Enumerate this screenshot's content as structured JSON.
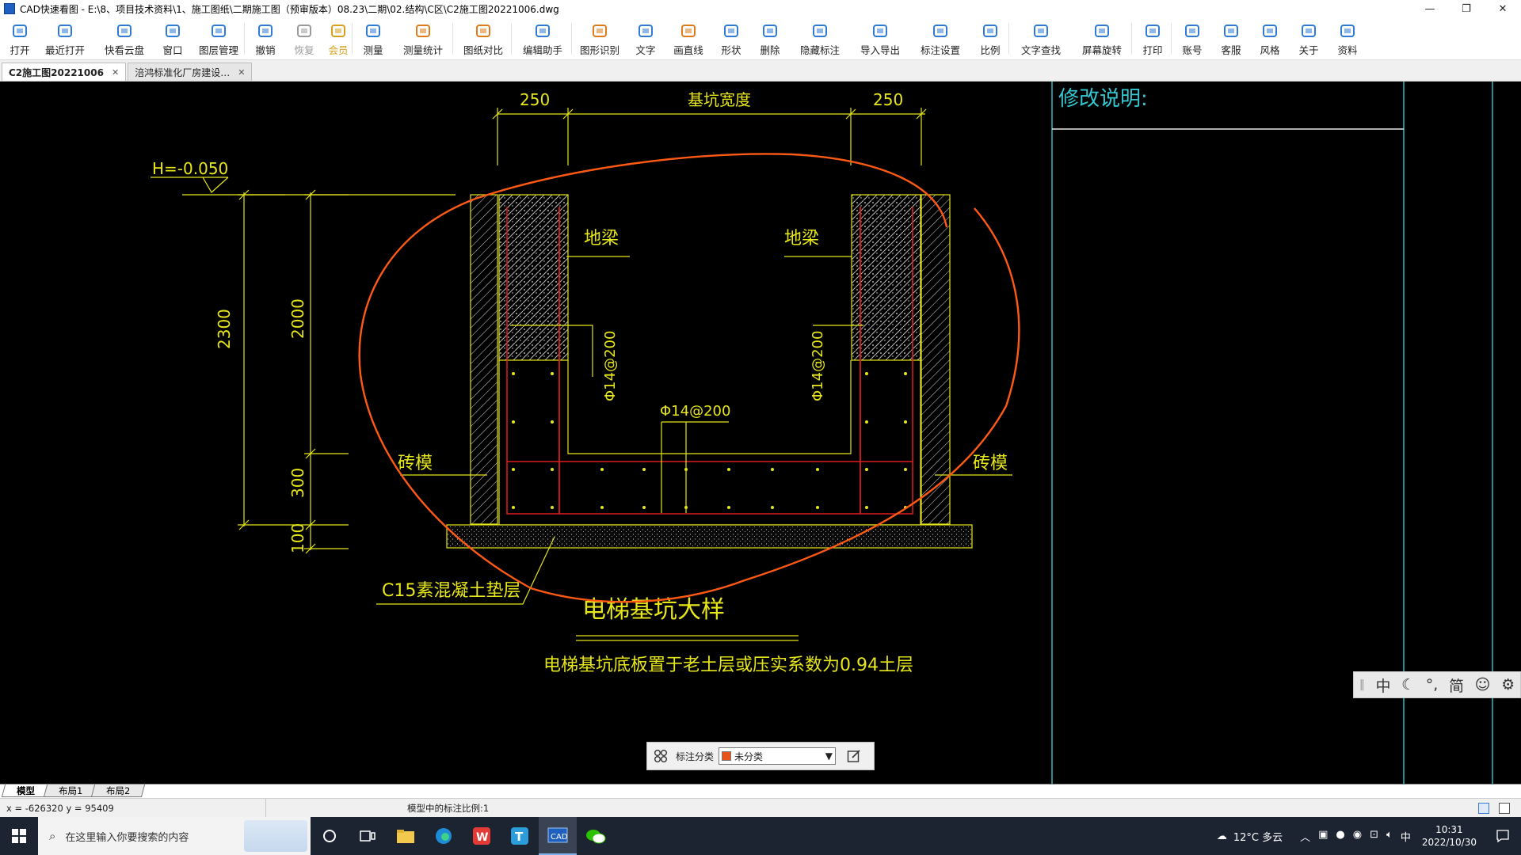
{
  "window": {
    "title": "CAD快速看图 - E:\\8、项目技术资料\\1、施工图纸\\二期施工图（预审版本）08.23\\二期\\02.结构\\C区\\C2施工图20221006.dwg",
    "minimize": "—",
    "maximize": "❐",
    "close": "✕"
  },
  "toolbar": {
    "items": [
      {
        "label": "打开",
        "icon": "folder-open-icon",
        "color": "#2e7bd6"
      },
      {
        "label": "最近打开",
        "icon": "history-icon",
        "color": "#2e7bd6"
      },
      {
        "label": "快看云盘",
        "icon": "cloud-icon",
        "color": "#2e7bd6"
      },
      {
        "label": "窗口",
        "icon": "window-icon",
        "color": "#2e7bd6"
      },
      {
        "label": "图层管理",
        "icon": "layers-icon",
        "color": "#2e7bd6"
      },
      {
        "label": "撤销",
        "icon": "undo-icon",
        "color": "#2e7bd6"
      },
      {
        "label": "恢复",
        "icon": "redo-icon",
        "color": "#9a9a9a"
      },
      {
        "label": "会员",
        "icon": "vip-icon",
        "color": "#d9a11b"
      },
      {
        "label": "测量",
        "icon": "measure-icon",
        "color": "#2e7bd6"
      },
      {
        "label": "测量统计",
        "icon": "measure-stats-icon",
        "color": "#e07b1a"
      },
      {
        "label": "图纸对比",
        "icon": "compare-icon",
        "color": "#e07b1a"
      },
      {
        "label": "编辑助手",
        "icon": "edit-assistant-icon",
        "color": "#2e7bd6"
      },
      {
        "label": "图形识别",
        "icon": "shape-recognition-icon",
        "color": "#e07b1a"
      },
      {
        "label": "文字",
        "icon": "text-icon",
        "color": "#2e7bd6"
      },
      {
        "label": "画直线",
        "icon": "line-icon",
        "color": "#e07b1a"
      },
      {
        "label": "形状",
        "icon": "shape-icon",
        "color": "#2e7bd6"
      },
      {
        "label": "删除",
        "icon": "eraser-icon",
        "color": "#2e7bd6"
      },
      {
        "label": "隐藏标注",
        "icon": "hide-annotation-icon",
        "color": "#2e7bd6"
      },
      {
        "label": "导入导出",
        "icon": "import-export-icon",
        "color": "#2e7bd6"
      },
      {
        "label": "标注设置",
        "icon": "annotation-settings-icon",
        "color": "#2e7bd6"
      },
      {
        "label": "比例",
        "icon": "scale-icon",
        "color": "#2e7bd6"
      },
      {
        "label": "文字查找",
        "icon": "text-search-icon",
        "color": "#2e7bd6"
      },
      {
        "label": "屏幕旋转",
        "icon": "rotate-screen-icon",
        "color": "#2e7bd6"
      },
      {
        "label": "打印",
        "icon": "print-icon",
        "color": "#2e7bd6"
      },
      {
        "label": "账号",
        "icon": "account-icon",
        "color": "#2e7bd6"
      },
      {
        "label": "客服",
        "icon": "headset-icon",
        "color": "#2e7bd6"
      },
      {
        "label": "风格",
        "icon": "style-icon",
        "color": "#2e7bd6"
      },
      {
        "label": "关于",
        "icon": "info-icon",
        "color": "#2e7bd6"
      },
      {
        "label": "资料",
        "icon": "documents-icon",
        "color": "#2e7bd6"
      }
    ]
  },
  "doc_tabs": [
    {
      "label": "C2施工图20221006",
      "active": true
    },
    {
      "label": "涪鸿标准化厂房建设…",
      "active": false
    }
  ],
  "drawing": {
    "dim_top_left": "250",
    "dim_top_center": "基坑宽度",
    "dim_top_right": "250",
    "elevation": "H=-0.050",
    "dim_2300": "2300",
    "dim_2000": "2000",
    "dim_300": "300",
    "dim_100": "100",
    "label_beam_left": "地梁",
    "label_beam_right": "地梁",
    "label_rebar_left": "Φ14@200",
    "label_rebar_bottom": "Φ14@200",
    "label_rebar_right": "Φ14@200",
    "label_brick_left": "砖模",
    "label_brick_right": "砖模",
    "label_cushion": "C15素混凝土垫层",
    "title": "电梯基坑大样",
    "note": "电梯基坑底板置于老土层或压实系数为0.94土层",
    "revision_title": "修改说明:",
    "colors": {
      "line": "#e6e61a",
      "rebar": "#e01c1c",
      "markup": "#ff5a14",
      "border": "#34c8d2"
    }
  },
  "ime_bar": {
    "items": [
      "中",
      "☾",
      "°,",
      "简",
      "☺",
      "⚙"
    ]
  },
  "annotation_bar": {
    "label": "标注分类",
    "selected": "未分类",
    "swatch_color": "#e8531c"
  },
  "layout_tabs": [
    "模型",
    "布局1",
    "布局2"
  ],
  "status": {
    "coords": "x = -626320  y = 95409",
    "scale_text": "模型中的标注比例:1"
  },
  "taskbar": {
    "search_placeholder": "在这里输入你要搜索的内容",
    "weather": "12°C  多云",
    "ime": "中",
    "time": "10:31",
    "date": "2022/10/30"
  }
}
